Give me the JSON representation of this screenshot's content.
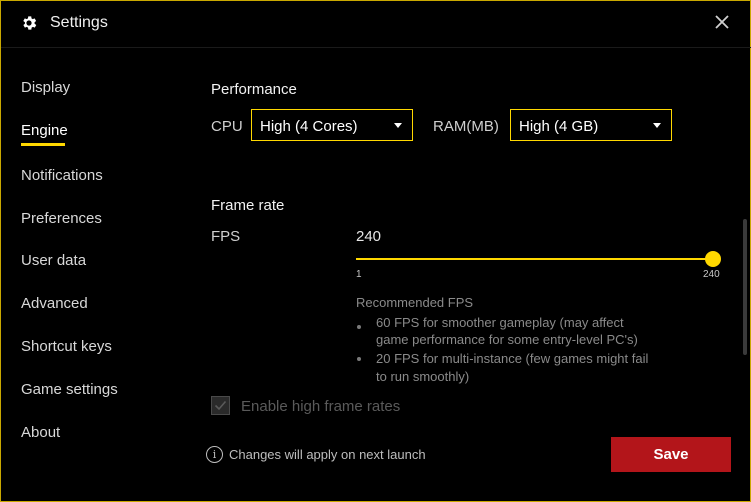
{
  "window": {
    "title": "Settings",
    "accent_color": "#ffd800",
    "save_color": "#b3151a",
    "icons": {
      "settings": "gear-icon",
      "close": "close-icon",
      "info": "info-icon"
    }
  },
  "sidebar": {
    "items": [
      {
        "label": "Display"
      },
      {
        "label": "Engine"
      },
      {
        "label": "Notifications"
      },
      {
        "label": "Preferences"
      },
      {
        "label": "User data"
      },
      {
        "label": "Advanced"
      },
      {
        "label": "Shortcut keys"
      },
      {
        "label": "Game settings"
      },
      {
        "label": "About"
      }
    ],
    "active": "Engine"
  },
  "performance": {
    "title": "Performance",
    "cpu_label": "CPU",
    "cpu_value": "High (4 Cores)",
    "ram_label": "RAM(MB)",
    "ram_value": "High (4 GB)"
  },
  "frame_rate": {
    "title": "Frame rate",
    "fps_label": "FPS",
    "fps_value": "240",
    "slider_min": "1",
    "slider_max": "240",
    "slider_level": 240,
    "recommended_title": "Recommended FPS",
    "recommendations": [
      {
        "line1": "60 FPS for smoother gameplay (may affect",
        "line2": "game performance for some entry-level PC's)"
      },
      {
        "line1": "20 FPS for multi-instance (few games might fail",
        "line2": "to run smoothly)"
      }
    ]
  },
  "high_frame_rates": {
    "label": "Enable high frame rates",
    "checked": true
  },
  "footer": {
    "info_text": "Changes will apply on next launch",
    "save_label": "Save"
  }
}
